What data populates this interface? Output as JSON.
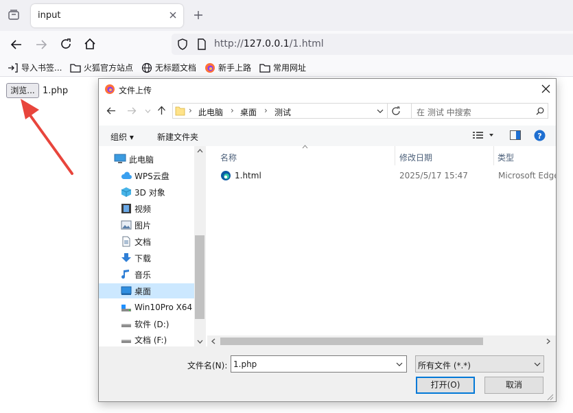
{
  "browser": {
    "tab_title": "input",
    "url_prefix": "http://",
    "url_host": "127.0.0.1",
    "url_path": "/1.html",
    "bookmarks": [
      "导入书签...",
      "火狐官方站点",
      "无标题文档",
      "新手上路",
      "常用网址"
    ]
  },
  "page": {
    "browse_label": "浏览...",
    "file_name": "1.php"
  },
  "dialog": {
    "title": "文件上传",
    "breadcrumb": [
      "此电脑",
      "桌面",
      "测试"
    ],
    "search_placeholder": "在 测试 中搜索",
    "organize_label": "组织 ▾",
    "new_folder_label": "新建文件夹",
    "nav_items": [
      {
        "label": "此电脑",
        "icon": "pc-icon"
      },
      {
        "label": "WPS云盘",
        "icon": "cloud-icon"
      },
      {
        "label": "3D 对象",
        "icon": "cube-icon"
      },
      {
        "label": "视频",
        "icon": "video-icon"
      },
      {
        "label": "图片",
        "icon": "picture-icon"
      },
      {
        "label": "文档",
        "icon": "document-icon"
      },
      {
        "label": "下载",
        "icon": "download-icon"
      },
      {
        "label": "音乐",
        "icon": "music-icon"
      },
      {
        "label": "桌面",
        "icon": "desktop-icon"
      },
      {
        "label": "Win10Pro X64",
        "icon": "drive-icon"
      },
      {
        "label": "软件 (D:)",
        "icon": "drive-icon"
      },
      {
        "label": "文档 (F:)",
        "icon": "drive-icon"
      }
    ],
    "selected_nav": "桌面",
    "columns": [
      "名称",
      "修改日期",
      "类型"
    ],
    "files": [
      {
        "name": "1.html",
        "modified": "2025/5/17 15:47",
        "type": "Microsoft Edge"
      }
    ],
    "filename_label": "文件名(N):",
    "filename_value": "1.php",
    "filetype_value": "所有文件 (*.*)",
    "open_label": "打开(O)",
    "cancel_label": "取消"
  },
  "colors": {
    "accent": "#0078d7",
    "arrow": "#e8453c",
    "selection": "#cce8ff"
  }
}
